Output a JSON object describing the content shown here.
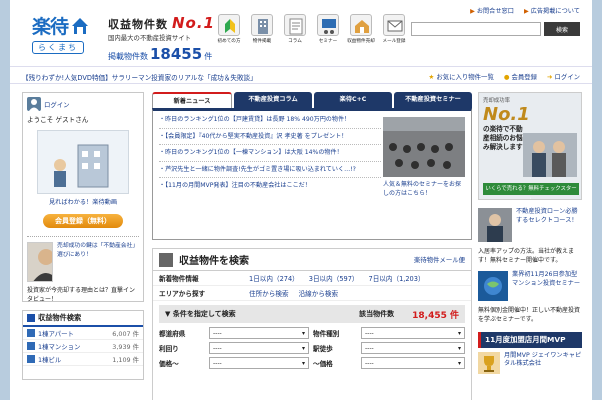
{
  "header": {
    "logo_main": "楽待",
    "logo_sub": "らくまち",
    "tagline_line1": "収益物件数",
    "tagline_no1": "No.1",
    "tagline_line2": "国内最大の不動産投資サイト",
    "listing_label": "掲載物件数",
    "listing_count": "18455",
    "listing_unit": "件",
    "nav": [
      {
        "label": "初めての方",
        "icon": "beginner-icon"
      },
      {
        "label": "物件掲載",
        "icon": "building-icon"
      },
      {
        "label": "コラム",
        "icon": "column-icon"
      },
      {
        "label": "セミナー",
        "icon": "seminar-icon"
      },
      {
        "label": "収益物件売却",
        "icon": "sale-icon"
      },
      {
        "label": "メール登録",
        "icon": "mail-icon"
      }
    ],
    "top_links": [
      "お問合せ窓口",
      "広告掲載について"
    ],
    "search_placeholder": "",
    "search_button": "検索"
  },
  "subbar": {
    "promo": "【残りわずか!人気DVD特価】サラリーマン投資家のリアルな「成功＆失敗談」",
    "links": [
      "お気に入り物件一覧",
      "会員登録",
      "ログイン"
    ]
  },
  "login": {
    "login_link": "ログイン",
    "welcome": "ようこそ ゲストさん",
    "video_link": "見ればわかる！楽待動画",
    "register_button": "会員登録（無料）",
    "profile_text": "売却成功の鍵は「不動産会社」選びにあり！",
    "question": "投資家が今売却する理由とは？直撃インタビュー！"
  },
  "categories": {
    "title": "収益物件検索",
    "items": [
      {
        "label": "1棟アパート",
        "count": "6,007 件"
      },
      {
        "label": "1棟マンション",
        "count": "3,939 件"
      },
      {
        "label": "1棟ビル",
        "count": "1,109 件"
      }
    ]
  },
  "tabs": [
    "新着ニュース",
    "不動産投資コラム",
    "楽待C+C",
    "不動産投資セミナー"
  ],
  "news": [
    "・昨日のランキング1位の【戸建賃貸】は長野 18% 490万円の物件！",
    "・【会員限定】『40代から堅実不動産投資』沢 孝史著 をプレゼント！",
    "・昨日のランキング1位の【一棟マンション】は大阪 14%の物件！",
    "・芦沢先生と一緒に物件調査!先生がゴミ置き場に吸い込まれていく…!?",
    "・【11月の月間MVP発表】注目の不動産会社はここだ！"
  ],
  "news_photo_caption": "人気＆無料のセミナーをお探しの方はこちら！",
  "search": {
    "title": "収益物件を検索",
    "link": "楽待物件メール便",
    "new_label": "新着物件情報",
    "new_links": [
      "1日以内（274）",
      "3日以内（597）",
      "7日以内（1,203）"
    ],
    "area_label": "エリアから探す",
    "area_links": [
      "住所から検索",
      "沿線から検索"
    ],
    "cond_label": "条件を指定して検索",
    "count_label": "該当物件数",
    "count_value": "18,455 件",
    "fields": [
      {
        "label": "都道府県",
        "value": "----"
      },
      {
        "label": "物件種別",
        "value": "----"
      },
      {
        "label": "利回り",
        "value": "----"
      },
      {
        "label": "駅徒歩",
        "value": "----"
      },
      {
        "label": "価格〜",
        "value": "----"
      },
      {
        "label": "〜価格",
        "value": "----"
      }
    ]
  },
  "right": {
    "banner_small": "売却成功率",
    "banner_no1": "No.1",
    "banner_text": "の楽待で不動産相続のお悩み解決します",
    "banner_button": "いくらで売れる？無料チェックスタート",
    "seminar_title": "不動産投資ローン必勝するセレクトコース！",
    "seminar_desc": "入居率アップの方法。当社が教えます！無料セミナー開催中です。",
    "seminar2_title": "業界初11月26日参加型マンション投資セミナー",
    "seminar2_desc": "無料個別金開催中！正しい不動産投資を学ぶセミナーです。",
    "mvp_head": "11月度加盟店月間MVP",
    "mvp_name": "月間MVP ジェイワンキャピタル株式会社"
  }
}
